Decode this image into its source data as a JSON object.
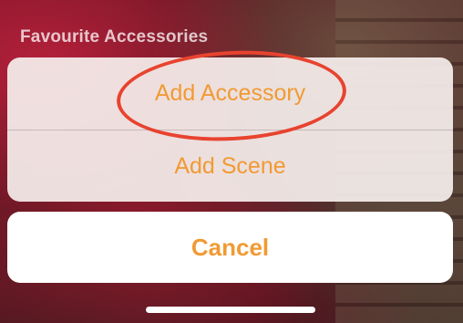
{
  "background": {
    "header_title": "Favourite Accessories"
  },
  "action_sheet": {
    "actions": [
      {
        "label": "Add Accessory"
      },
      {
        "label": "Add Scene"
      }
    ],
    "cancel_label": "Cancel"
  },
  "colors": {
    "accent": "#f19a33",
    "annotation_ring": "#e8432f"
  }
}
